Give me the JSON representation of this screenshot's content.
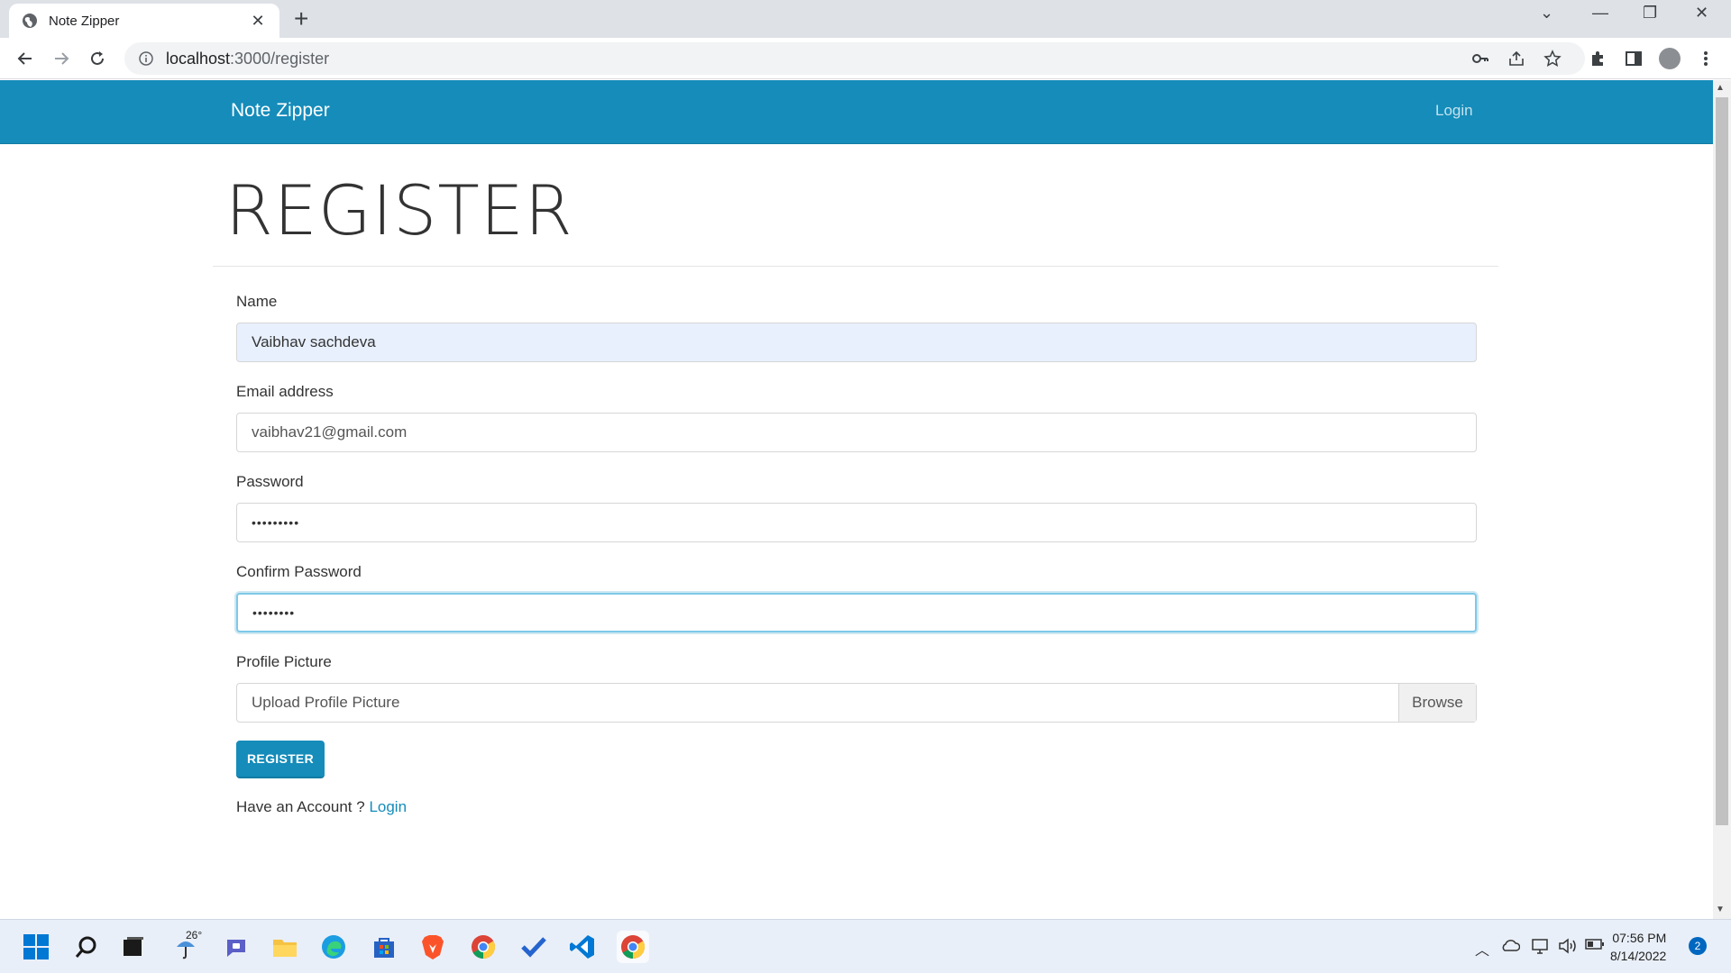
{
  "browser": {
    "tab_title": "Note Zipper",
    "url_host": "localhost",
    "url_path": ":3000/register"
  },
  "navbar": {
    "brand": "Note Zipper",
    "login_link": "Login"
  },
  "page": {
    "heading": "REGISTER"
  },
  "form": {
    "name_label": "Name",
    "name_value": "Vaibhav sachdeva",
    "email_label": "Email address",
    "email_value": "vaibhav21@gmail.com",
    "password_label": "Password",
    "password_value": "•••••••••",
    "confirm_label": "Confirm Password",
    "confirm_value": "••••••••",
    "picture_label": "Profile Picture",
    "picture_placeholder": "Upload Profile Picture",
    "browse_label": "Browse",
    "submit_label": "REGISTER",
    "have_account_text": "Have an Account ? ",
    "login_link": "Login"
  },
  "taskbar": {
    "weather_temp": "26°",
    "time": "07:56 PM",
    "date": "8/14/2022",
    "notification_count": "2"
  },
  "colors": {
    "primary": "#158cba",
    "autofill": "#e8f0fe"
  }
}
